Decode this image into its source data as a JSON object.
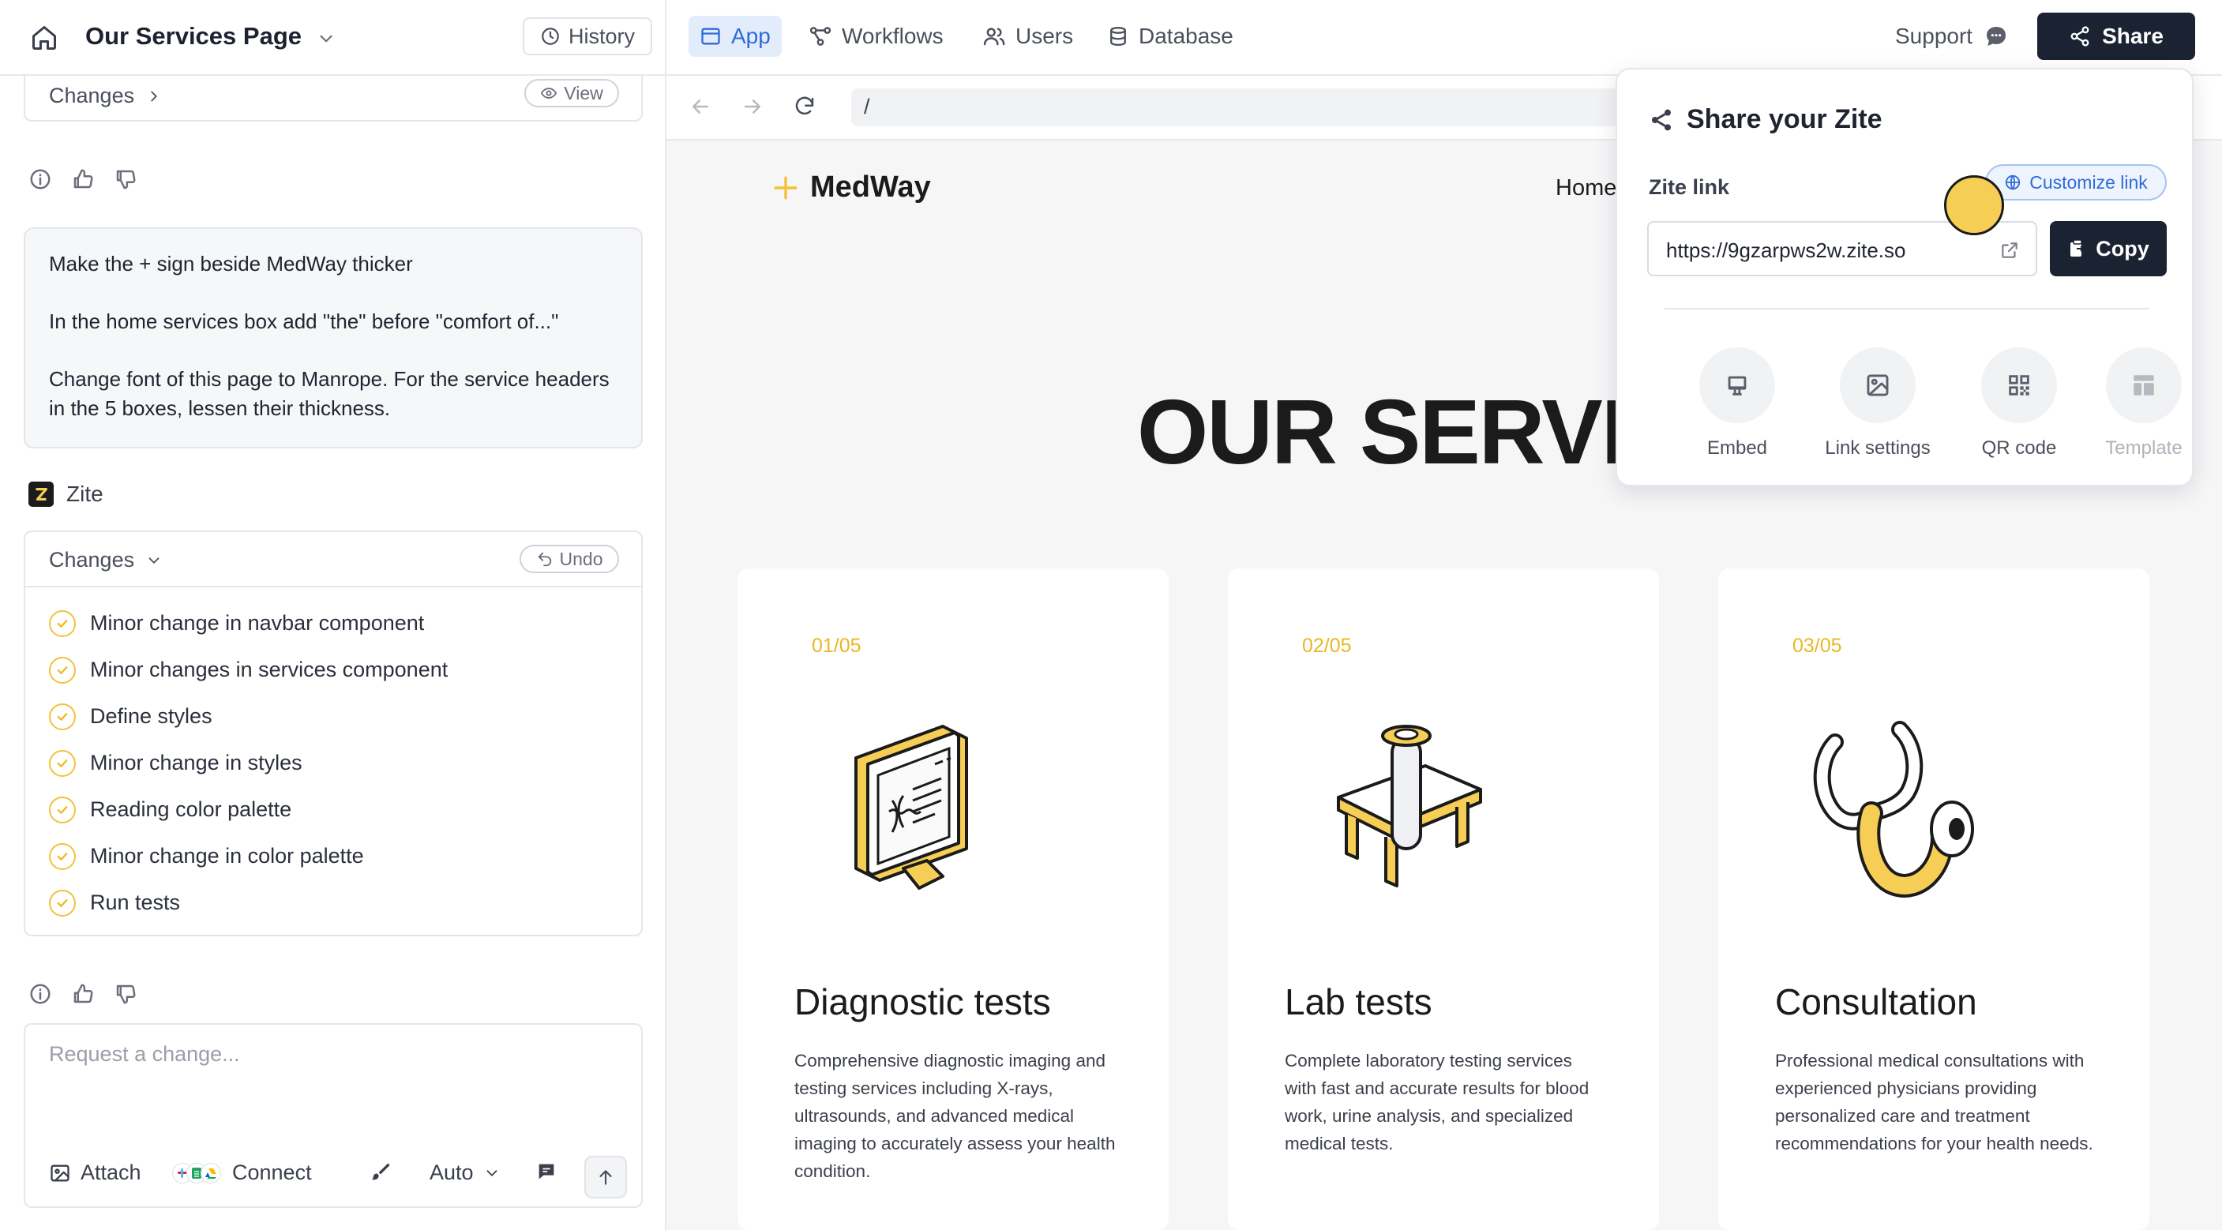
{
  "topbar": {
    "project_title": "Our Services Page",
    "history_label": "History",
    "tabs": [
      {
        "label": "App",
        "active": true
      },
      {
        "label": "Workflows"
      },
      {
        "label": "Users"
      },
      {
        "label": "Database"
      }
    ],
    "support_label": "Support",
    "share_label": "Share"
  },
  "chat": {
    "changes_collapsed_label": "Changes",
    "view_label": "View",
    "user_message": [
      "Make the + sign beside MedWay thicker",
      "In the home services box add \"the\" before \"comfort of...\"",
      "Change font of this page to Manrope. For the service headers in the 5 boxes, lessen their thickness."
    ],
    "assistant_name": "Zite",
    "changes_label": "Changes",
    "undo_label": "Undo",
    "changes": [
      "Minor change in navbar component",
      "Minor changes in services component",
      "Define styles",
      "Minor change in styles",
      "Reading color palette",
      "Minor change in color palette",
      "Run tests"
    ],
    "input_placeholder": "Request a change...",
    "attach_label": "Attach",
    "connect_label": "Connect",
    "model_label": "Auto"
  },
  "browser": {
    "url": "/"
  },
  "site": {
    "logo_text": "MedWay",
    "nav_home": "Home",
    "heading": "OUR SERVICES",
    "services": [
      {
        "num": "01/05",
        "title": "Diagnostic tests",
        "desc": "Comprehensive diagnostic imaging and testing services including X-rays, ultrasounds, and advanced medical imaging to accurately assess your health condition."
      },
      {
        "num": "02/05",
        "title": "Lab tests",
        "desc": "Complete laboratory testing services with fast and accurate results for blood work, urine analysis, and specialized medical tests."
      },
      {
        "num": "03/05",
        "title": "Consultation",
        "desc": "Professional medical consultations with experienced physicians providing personalized care and treatment recommendations for your health needs."
      }
    ]
  },
  "share_popup": {
    "title": "Share your Zite",
    "link_label": "Zite link",
    "customize_label": "Customize link",
    "link": "https://9gzarpws2w.zite.so",
    "copy_label": "Copy",
    "options": [
      {
        "label": "Embed",
        "icon": "monitor-icon"
      },
      {
        "label": "Link settings",
        "icon": "image-icon"
      },
      {
        "label": "QR code",
        "icon": "qr-code-icon"
      },
      {
        "label": "Template",
        "icon": "template-icon",
        "disabled": true
      }
    ]
  },
  "colors": {
    "accent_yellow": "#f6cd55",
    "brand_dark": "#1b2232",
    "link_blue": "#2f6bd8"
  }
}
